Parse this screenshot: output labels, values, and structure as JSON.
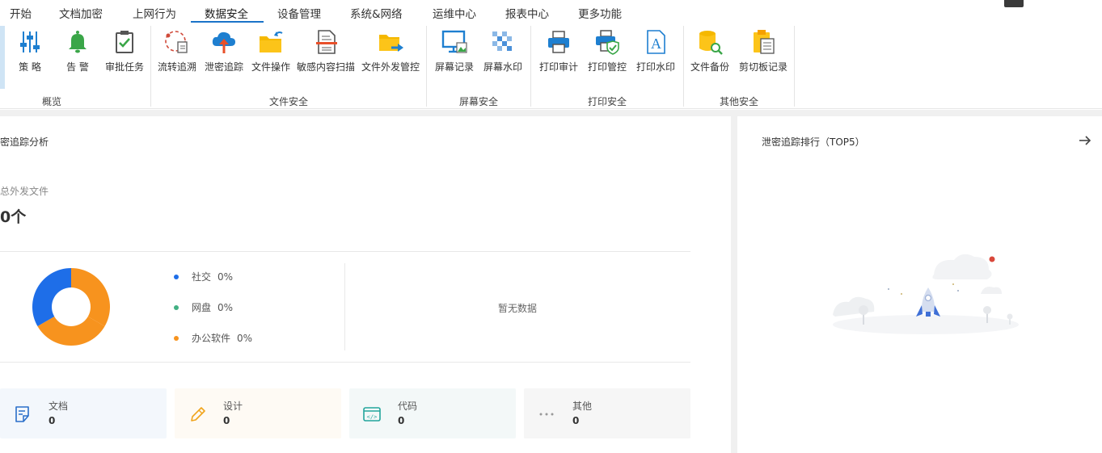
{
  "menu": {
    "tabs": [
      "开始",
      "文档加密",
      "上网行为",
      "数据安全",
      "设备管理",
      "系统&网络",
      "运维中心",
      "报表中心",
      "更多功能"
    ],
    "active": "数据安全"
  },
  "ribbon": {
    "overview": {
      "group": "概览",
      "items": [
        "策 略",
        "告 警",
        "审批任务"
      ]
    },
    "file_security": {
      "group": "文件安全",
      "items": [
        "流转追溯",
        "泄密追踪",
        "文件操作",
        "敏感内容扫描",
        "文件外发管控"
      ]
    },
    "screen_security": {
      "group": "屏幕安全",
      "items": [
        "屏幕记录",
        "屏幕水印"
      ]
    },
    "print_security": {
      "group": "打印安全",
      "items": [
        "打印审计",
        "打印管控",
        "打印水印"
      ]
    },
    "other_security": {
      "group": "其他安全",
      "items": [
        "文件备份",
        "剪切板记录"
      ]
    }
  },
  "left_panel": {
    "title": "密追踪分析",
    "total_label": "总外发文件",
    "total_value": "0个",
    "legend": [
      {
        "name": "社交",
        "pct": "0%",
        "color": "#1e6ee8"
      },
      {
        "name": "网盘",
        "pct": "0%",
        "color": "#43b083"
      },
      {
        "name": "办公软件",
        "pct": "0%",
        "color": "#f7931e"
      }
    ],
    "no_data": "暂无数据",
    "cards": [
      {
        "name": "文档",
        "value": "0",
        "bg": "#f3f7fc",
        "icon": "document-edit-icon"
      },
      {
        "name": "设计",
        "value": "0",
        "bg": "#fefaf4",
        "icon": "pencil-icon"
      },
      {
        "name": "代码",
        "value": "0",
        "bg": "#f3f8f8",
        "icon": "code-window-icon"
      },
      {
        "name": "其他",
        "value": "0",
        "bg": "#f6f6f6",
        "icon": "more-dots-icon"
      }
    ]
  },
  "right_panel": {
    "title": "泄密追踪排行（TOP5）"
  },
  "chart_data": {
    "type": "pie",
    "categories": [
      "社交",
      "网盘",
      "办公软件"
    ],
    "values": [
      0,
      0,
      0
    ],
    "legend_position": "right"
  }
}
